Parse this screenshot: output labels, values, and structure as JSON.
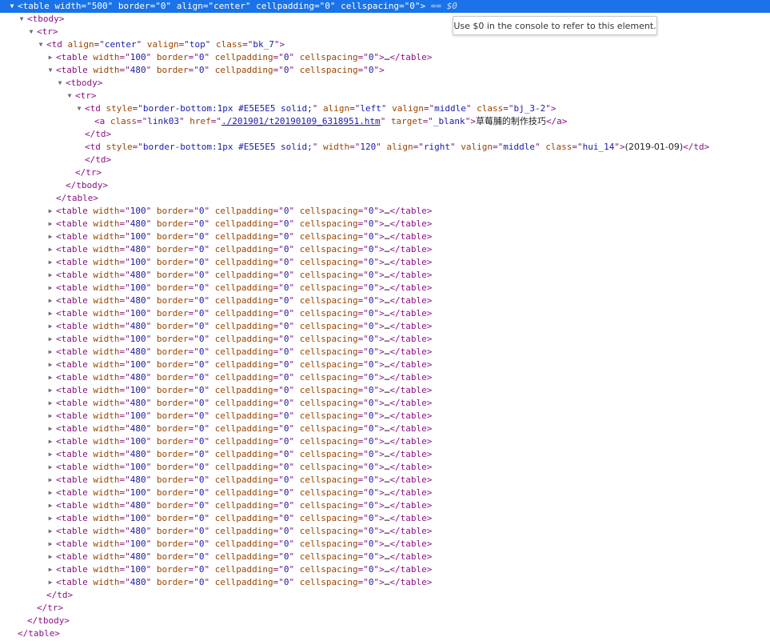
{
  "selected_suffix": " == $0",
  "tooltip": "Use $0 in the console to refer to this element.",
  "lines": [
    {
      "d": 0,
      "a": "down",
      "sel": true,
      "k": "open",
      "tag": "table",
      "attrs": [
        [
          "width",
          "500"
        ],
        [
          "border",
          "0"
        ],
        [
          "align",
          "center"
        ],
        [
          "cellpadding",
          "0"
        ],
        [
          "cellspacing",
          "0"
        ]
      ]
    },
    {
      "d": 1,
      "a": "down",
      "k": "open",
      "tag": "tbody",
      "attrs": []
    },
    {
      "d": 2,
      "a": "down",
      "k": "open",
      "tag": "tr",
      "attrs": []
    },
    {
      "d": 3,
      "a": "down",
      "k": "open",
      "tag": "td",
      "attrs": [
        [
          "align",
          "center"
        ],
        [
          "valign",
          "top"
        ],
        [
          "class",
          "bk_7"
        ]
      ]
    },
    {
      "d": 4,
      "a": "right",
      "k": "collapsed",
      "tag": "table",
      "attrs": [
        [
          "width",
          "100"
        ],
        [
          "border",
          "0"
        ],
        [
          "cellpadding",
          "0"
        ],
        [
          "cellspacing",
          "0"
        ]
      ]
    },
    {
      "d": 4,
      "a": "down",
      "k": "open",
      "tag": "table",
      "attrs": [
        [
          "width",
          "480"
        ],
        [
          "border",
          "0"
        ],
        [
          "cellpadding",
          "0"
        ],
        [
          "cellspacing",
          "0"
        ]
      ]
    },
    {
      "d": 5,
      "a": "down",
      "k": "open",
      "tag": "tbody",
      "attrs": []
    },
    {
      "d": 6,
      "a": "down",
      "k": "open",
      "tag": "tr",
      "attrs": []
    },
    {
      "d": 7,
      "a": "down",
      "k": "open",
      "tag": "td",
      "attrs": [
        [
          "style",
          "border-bottom:1px #E5E5E5 solid;"
        ],
        [
          "align",
          "left"
        ],
        [
          "valign",
          "middle"
        ],
        [
          "class",
          "bj_3-2"
        ]
      ]
    },
    {
      "d": 8,
      "a": "",
      "k": "link",
      "tag": "a",
      "attrs": [
        [
          "class",
          "link03"
        ],
        [
          "href",
          "./201901/t20190109_6318951.htm"
        ],
        [
          "target",
          "_blank"
        ]
      ],
      "text": "草莓脯的制作技巧"
    },
    {
      "d": 7,
      "a": "",
      "k": "close",
      "tag": "td"
    },
    {
      "d": 7,
      "a": "",
      "k": "inline",
      "tag": "td",
      "attrs": [
        [
          "style",
          "border-bottom:1px #E5E5E5 solid;"
        ],
        [
          "width",
          "120"
        ],
        [
          "align",
          "right"
        ],
        [
          "valign",
          "middle"
        ],
        [
          "class",
          "hui_14"
        ]
      ],
      "text": "(2019-01-09)"
    },
    {
      "d": 7,
      "a": "",
      "k": "close",
      "tag": "td"
    },
    {
      "d": 6,
      "a": "",
      "k": "close",
      "tag": "tr"
    },
    {
      "d": 5,
      "a": "",
      "k": "close",
      "tag": "tbody"
    },
    {
      "d": 4,
      "a": "",
      "k": "close",
      "tag": "table"
    },
    {
      "d": 4,
      "a": "right",
      "k": "collapsed",
      "tag": "table",
      "attrs": [
        [
          "width",
          "100"
        ],
        [
          "border",
          "0"
        ],
        [
          "cellpadding",
          "0"
        ],
        [
          "cellspacing",
          "0"
        ]
      ]
    },
    {
      "d": 4,
      "a": "right",
      "k": "collapsed",
      "tag": "table",
      "attrs": [
        [
          "width",
          "480"
        ],
        [
          "border",
          "0"
        ],
        [
          "cellpadding",
          "0"
        ],
        [
          "cellspacing",
          "0"
        ]
      ]
    },
    {
      "d": 4,
      "a": "right",
      "k": "collapsed",
      "tag": "table",
      "attrs": [
        [
          "width",
          "100"
        ],
        [
          "border",
          "0"
        ],
        [
          "cellpadding",
          "0"
        ],
        [
          "cellspacing",
          "0"
        ]
      ]
    },
    {
      "d": 4,
      "a": "right",
      "k": "collapsed",
      "tag": "table",
      "attrs": [
        [
          "width",
          "480"
        ],
        [
          "border",
          "0"
        ],
        [
          "cellpadding",
          "0"
        ],
        [
          "cellspacing",
          "0"
        ]
      ]
    },
    {
      "d": 4,
      "a": "right",
      "k": "collapsed",
      "tag": "table",
      "attrs": [
        [
          "width",
          "100"
        ],
        [
          "border",
          "0"
        ],
        [
          "cellpadding",
          "0"
        ],
        [
          "cellspacing",
          "0"
        ]
      ]
    },
    {
      "d": 4,
      "a": "right",
      "k": "collapsed",
      "tag": "table",
      "attrs": [
        [
          "width",
          "480"
        ],
        [
          "border",
          "0"
        ],
        [
          "cellpadding",
          "0"
        ],
        [
          "cellspacing",
          "0"
        ]
      ]
    },
    {
      "d": 4,
      "a": "right",
      "k": "collapsed",
      "tag": "table",
      "attrs": [
        [
          "width",
          "100"
        ],
        [
          "border",
          "0"
        ],
        [
          "cellpadding",
          "0"
        ],
        [
          "cellspacing",
          "0"
        ]
      ]
    },
    {
      "d": 4,
      "a": "right",
      "k": "collapsed",
      "tag": "table",
      "attrs": [
        [
          "width",
          "480"
        ],
        [
          "border",
          "0"
        ],
        [
          "cellpadding",
          "0"
        ],
        [
          "cellspacing",
          "0"
        ]
      ]
    },
    {
      "d": 4,
      "a": "right",
      "k": "collapsed",
      "tag": "table",
      "attrs": [
        [
          "width",
          "100"
        ],
        [
          "border",
          "0"
        ],
        [
          "cellpadding",
          "0"
        ],
        [
          "cellspacing",
          "0"
        ]
      ]
    },
    {
      "d": 4,
      "a": "right",
      "k": "collapsed",
      "tag": "table",
      "attrs": [
        [
          "width",
          "480"
        ],
        [
          "border",
          "0"
        ],
        [
          "cellpadding",
          "0"
        ],
        [
          "cellspacing",
          "0"
        ]
      ]
    },
    {
      "d": 4,
      "a": "right",
      "k": "collapsed",
      "tag": "table",
      "attrs": [
        [
          "width",
          "100"
        ],
        [
          "border",
          "0"
        ],
        [
          "cellpadding",
          "0"
        ],
        [
          "cellspacing",
          "0"
        ]
      ]
    },
    {
      "d": 4,
      "a": "right",
      "k": "collapsed",
      "tag": "table",
      "attrs": [
        [
          "width",
          "480"
        ],
        [
          "border",
          "0"
        ],
        [
          "cellpadding",
          "0"
        ],
        [
          "cellspacing",
          "0"
        ]
      ]
    },
    {
      "d": 4,
      "a": "right",
      "k": "collapsed",
      "tag": "table",
      "attrs": [
        [
          "width",
          "100"
        ],
        [
          "border",
          "0"
        ],
        [
          "cellpadding",
          "0"
        ],
        [
          "cellspacing",
          "0"
        ]
      ]
    },
    {
      "d": 4,
      "a": "right",
      "k": "collapsed",
      "tag": "table",
      "attrs": [
        [
          "width",
          "480"
        ],
        [
          "border",
          "0"
        ],
        [
          "cellpadding",
          "0"
        ],
        [
          "cellspacing",
          "0"
        ]
      ]
    },
    {
      "d": 4,
      "a": "right",
      "k": "collapsed",
      "tag": "table",
      "attrs": [
        [
          "width",
          "100"
        ],
        [
          "border",
          "0"
        ],
        [
          "cellpadding",
          "0"
        ],
        [
          "cellspacing",
          "0"
        ]
      ]
    },
    {
      "d": 4,
      "a": "right",
      "k": "collapsed",
      "tag": "table",
      "attrs": [
        [
          "width",
          "480"
        ],
        [
          "border",
          "0"
        ],
        [
          "cellpadding",
          "0"
        ],
        [
          "cellspacing",
          "0"
        ]
      ]
    },
    {
      "d": 4,
      "a": "right",
      "k": "collapsed",
      "tag": "table",
      "attrs": [
        [
          "width",
          "100"
        ],
        [
          "border",
          "0"
        ],
        [
          "cellpadding",
          "0"
        ],
        [
          "cellspacing",
          "0"
        ]
      ]
    },
    {
      "d": 4,
      "a": "right",
      "k": "collapsed",
      "tag": "table",
      "attrs": [
        [
          "width",
          "480"
        ],
        [
          "border",
          "0"
        ],
        [
          "cellpadding",
          "0"
        ],
        [
          "cellspacing",
          "0"
        ]
      ]
    },
    {
      "d": 4,
      "a": "right",
      "k": "collapsed",
      "tag": "table",
      "attrs": [
        [
          "width",
          "100"
        ],
        [
          "border",
          "0"
        ],
        [
          "cellpadding",
          "0"
        ],
        [
          "cellspacing",
          "0"
        ]
      ]
    },
    {
      "d": 4,
      "a": "right",
      "k": "collapsed",
      "tag": "table",
      "attrs": [
        [
          "width",
          "480"
        ],
        [
          "border",
          "0"
        ],
        [
          "cellpadding",
          "0"
        ],
        [
          "cellspacing",
          "0"
        ]
      ]
    },
    {
      "d": 4,
      "a": "right",
      "k": "collapsed",
      "tag": "table",
      "attrs": [
        [
          "width",
          "100"
        ],
        [
          "border",
          "0"
        ],
        [
          "cellpadding",
          "0"
        ],
        [
          "cellspacing",
          "0"
        ]
      ]
    },
    {
      "d": 4,
      "a": "right",
      "k": "collapsed",
      "tag": "table",
      "attrs": [
        [
          "width",
          "480"
        ],
        [
          "border",
          "0"
        ],
        [
          "cellpadding",
          "0"
        ],
        [
          "cellspacing",
          "0"
        ]
      ]
    },
    {
      "d": 4,
      "a": "right",
      "k": "collapsed",
      "tag": "table",
      "attrs": [
        [
          "width",
          "100"
        ],
        [
          "border",
          "0"
        ],
        [
          "cellpadding",
          "0"
        ],
        [
          "cellspacing",
          "0"
        ]
      ]
    },
    {
      "d": 4,
      "a": "right",
      "k": "collapsed",
      "tag": "table",
      "attrs": [
        [
          "width",
          "480"
        ],
        [
          "border",
          "0"
        ],
        [
          "cellpadding",
          "0"
        ],
        [
          "cellspacing",
          "0"
        ]
      ]
    },
    {
      "d": 4,
      "a": "right",
      "k": "collapsed",
      "tag": "table",
      "attrs": [
        [
          "width",
          "100"
        ],
        [
          "border",
          "0"
        ],
        [
          "cellpadding",
          "0"
        ],
        [
          "cellspacing",
          "0"
        ]
      ]
    },
    {
      "d": 4,
      "a": "right",
      "k": "collapsed",
      "tag": "table",
      "attrs": [
        [
          "width",
          "480"
        ],
        [
          "border",
          "0"
        ],
        [
          "cellpadding",
          "0"
        ],
        [
          "cellspacing",
          "0"
        ]
      ]
    },
    {
      "d": 4,
      "a": "right",
      "k": "collapsed",
      "tag": "table",
      "attrs": [
        [
          "width",
          "100"
        ],
        [
          "border",
          "0"
        ],
        [
          "cellpadding",
          "0"
        ],
        [
          "cellspacing",
          "0"
        ]
      ]
    },
    {
      "d": 4,
      "a": "right",
      "k": "collapsed",
      "tag": "table",
      "attrs": [
        [
          "width",
          "480"
        ],
        [
          "border",
          "0"
        ],
        [
          "cellpadding",
          "0"
        ],
        [
          "cellspacing",
          "0"
        ]
      ]
    },
    {
      "d": 4,
      "a": "right",
      "k": "collapsed",
      "tag": "table",
      "attrs": [
        [
          "width",
          "100"
        ],
        [
          "border",
          "0"
        ],
        [
          "cellpadding",
          "0"
        ],
        [
          "cellspacing",
          "0"
        ]
      ]
    },
    {
      "d": 4,
      "a": "right",
      "k": "collapsed",
      "tag": "table",
      "attrs": [
        [
          "width",
          "480"
        ],
        [
          "border",
          "0"
        ],
        [
          "cellpadding",
          "0"
        ],
        [
          "cellspacing",
          "0"
        ]
      ]
    },
    {
      "d": 3,
      "a": "",
      "k": "close",
      "tag": "td"
    },
    {
      "d": 2,
      "a": "",
      "k": "close",
      "tag": "tr"
    },
    {
      "d": 1,
      "a": "",
      "k": "close",
      "tag": "tbody"
    },
    {
      "d": 0,
      "a": "",
      "k": "close",
      "tag": "table"
    }
  ]
}
